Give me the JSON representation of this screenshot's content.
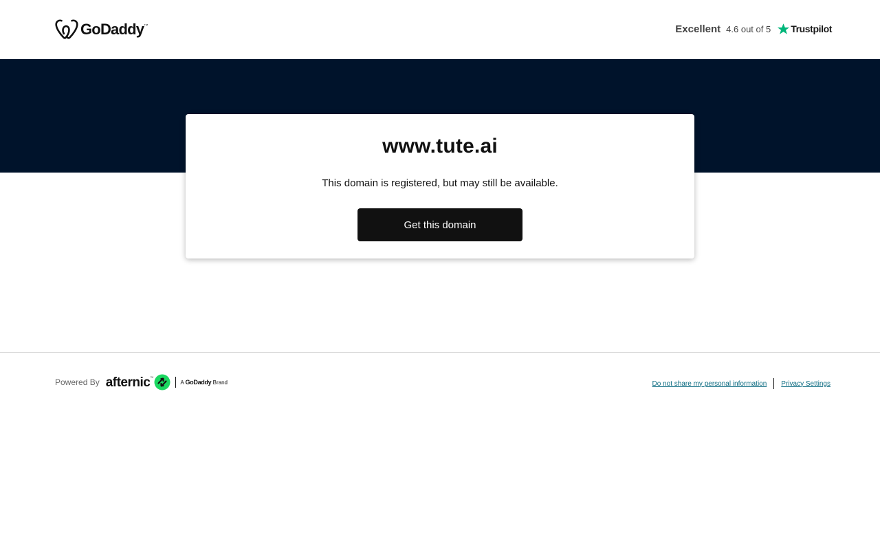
{
  "header": {
    "brand": "GoDaddy",
    "brand_tm": "™",
    "logo_icon": "godaddy-heart-icon",
    "rating": {
      "label": "Excellent",
      "score": "4.6 out of 5",
      "provider": "Trustpilot",
      "star_icon": "trustpilot-star-icon",
      "star_color": "#00b67a"
    }
  },
  "hero": {
    "band_color": "#00132b"
  },
  "card": {
    "domain": "www.tute.ai",
    "status": "This domain is registered, but may still be available.",
    "cta_label": "Get this domain"
  },
  "footer": {
    "powered_by": "Powered By",
    "partner": "afternic",
    "partner_tm": "™",
    "partner_icon": "afternic-icon",
    "partner_icon_color": "#1bd760",
    "brand_prefix": "A",
    "brand_name": "GoDaddy",
    "brand_suffix": "Brand",
    "links": {
      "do_not_share": "Do not share my personal information",
      "privacy": "Privacy Settings"
    },
    "link_color": "#0a6a80"
  }
}
